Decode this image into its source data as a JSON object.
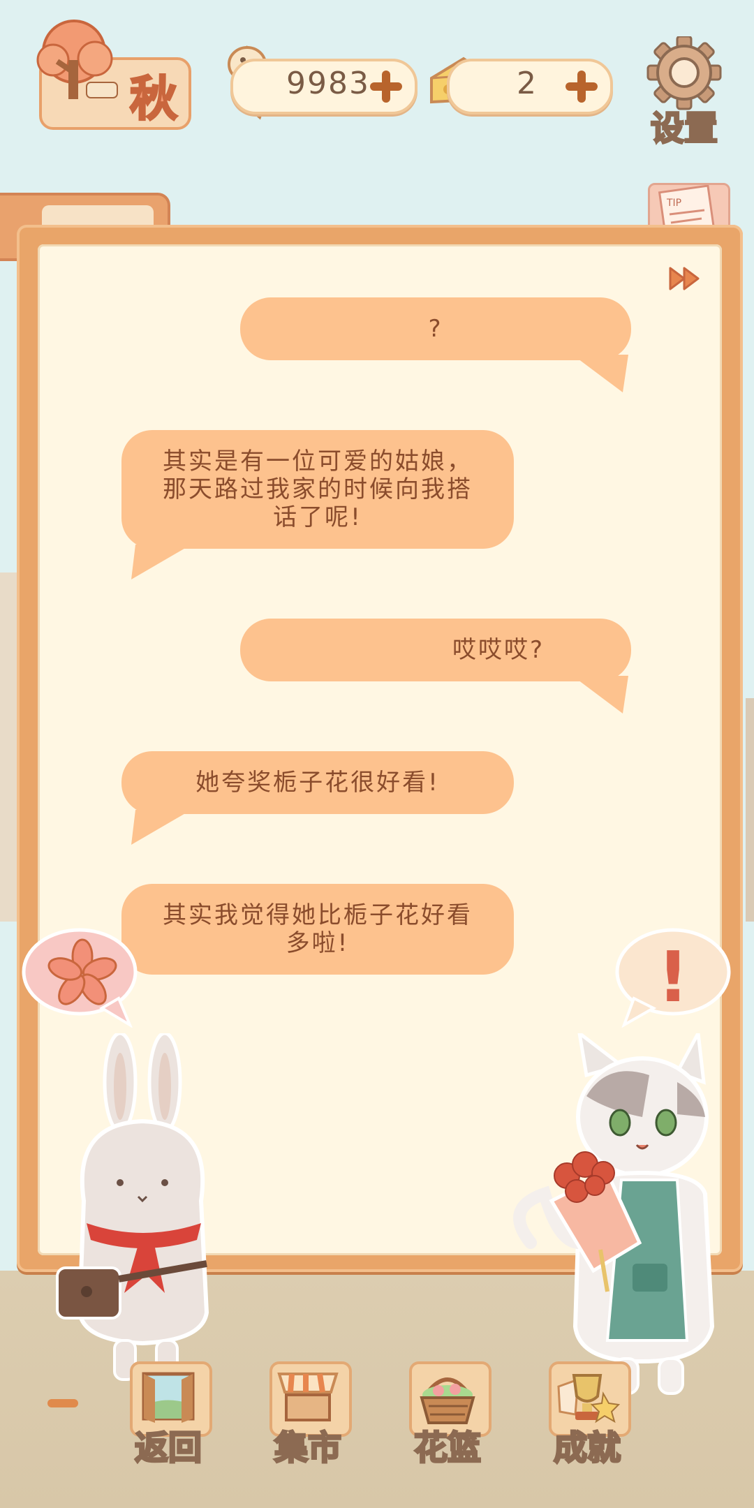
{
  "header": {
    "season_label": "秋",
    "fishbone_count": "9983",
    "cheese_count": "2",
    "settings_label": "设置"
  },
  "board": {
    "tip_label": "TIP"
  },
  "dialog": {
    "messages": [
      {
        "side": "right",
        "text": "?"
      },
      {
        "side": "left",
        "text": "其实是有一位可爱的姑娘，\n那天路过我家的时候向我搭\n话了呢!"
      },
      {
        "side": "right",
        "text": "哎哎哎?"
      },
      {
        "side": "left",
        "text": "她夸奖栀子花很好看!"
      },
      {
        "side": "left",
        "text": "其实我觉得她比栀子花好看\n多啦!"
      }
    ]
  },
  "cat_reaction": "!",
  "bottom_nav": {
    "items": [
      {
        "label": "返回"
      },
      {
        "label": "集市"
      },
      {
        "label": "花篮"
      },
      {
        "label": "成就"
      }
    ]
  },
  "colors": {
    "bubble": "#fdc28e",
    "bubble_text": "#8a4c2c",
    "board_frame": "#e9a569",
    "board_paper": "#fff7e3"
  }
}
